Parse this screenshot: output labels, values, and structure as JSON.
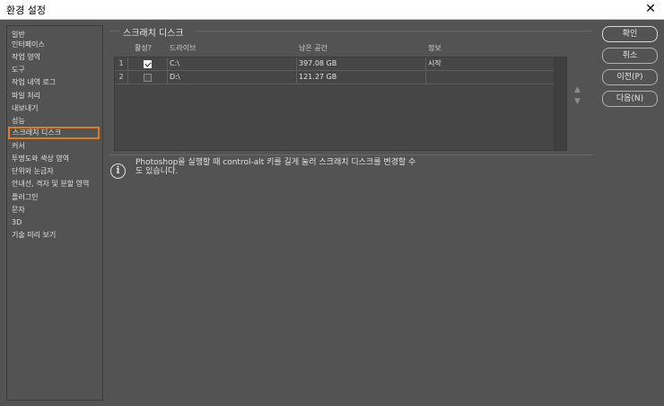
{
  "window": {
    "title": "환경 설정",
    "close_glyph": "✕"
  },
  "sidebar": {
    "items": [
      {
        "label": "일반"
      },
      {
        "label": "인터페이스"
      },
      {
        "label": "작업 영역"
      },
      {
        "label": "도구"
      },
      {
        "label": "작업 내역 로그"
      },
      {
        "label": "파일 처리"
      },
      {
        "label": "내보내기"
      },
      {
        "label": "성능"
      },
      {
        "label": "스크래치 디스크",
        "selected": true
      },
      {
        "label": "커서"
      },
      {
        "label": "투명도와 색상 영역"
      },
      {
        "label": "단위와 눈금자"
      },
      {
        "label": "안내선, 격자 및 분할 영역"
      },
      {
        "label": "플러그인"
      },
      {
        "label": "문자"
      },
      {
        "label": "3D"
      },
      {
        "label": "기술 미리 보기"
      }
    ]
  },
  "section": {
    "title": "스크래치 디스크"
  },
  "table": {
    "headers": {
      "active": "활성?",
      "drive": "드라이브",
      "free_space": "남은 공간",
      "info": "정보"
    },
    "rows": [
      {
        "num": "1",
        "active": true,
        "drive": "C:\\",
        "free_space": "397.08 GB",
        "info": "시작"
      },
      {
        "num": "2",
        "active": false,
        "drive": "D:\\",
        "free_space": "121.27 GB",
        "info": ""
      }
    ]
  },
  "reorder": {
    "up_icon": "arrow-up-icon",
    "down_icon": "arrow-down-icon",
    "up_glyph": "▲",
    "down_glyph": "▼"
  },
  "info": {
    "icon": "info-icon",
    "icon_glyph": "i",
    "line1": "Photoshop을 실행할 때 control-alt 키를 길게 눌러 스크래치 디스크를 변경할 수",
    "line2": "도 있습니다."
  },
  "buttons": {
    "ok": "확인",
    "cancel": "취소",
    "prev": "이전(P)",
    "next": "다음(N)"
  },
  "colors": {
    "accent_selection": "#e07b1f",
    "background": "#535353",
    "table_bg": "#464646"
  }
}
